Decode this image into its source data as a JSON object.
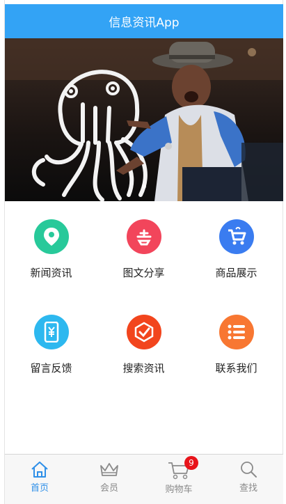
{
  "header": {
    "title": "信息资讯App"
  },
  "banner": {
    "description_icon": "photo-banner"
  },
  "grid": {
    "items": [
      {
        "label": "新闻资讯",
        "color": "#28c99a",
        "icon": "location-pin-icon"
      },
      {
        "label": "图文分享",
        "color": "#f2455b",
        "icon": "share-icon"
      },
      {
        "label": "商品展示",
        "color": "#3a7cf0",
        "icon": "cart-icon"
      },
      {
        "label": "留言反馈",
        "color": "#2db8ef",
        "icon": "phone-yen-icon"
      },
      {
        "label": "搜索资讯",
        "color": "#f2451d",
        "icon": "check-hexagon-icon"
      },
      {
        "label": "联系我们",
        "color": "#f87732",
        "icon": "list-icon"
      }
    ]
  },
  "tabbar": {
    "tabs": [
      {
        "label": "首页",
        "icon": "home-icon",
        "active": true
      },
      {
        "label": "会员",
        "icon": "crown-icon",
        "active": false
      },
      {
        "label": "购物车",
        "icon": "cart-outline-icon",
        "active": false,
        "badge": "9"
      },
      {
        "label": "查找",
        "icon": "search-icon",
        "active": false
      }
    ]
  },
  "colors": {
    "header_bg": "#33a3f5",
    "active_tab": "#2e8fe8",
    "badge": "#e8141b"
  }
}
